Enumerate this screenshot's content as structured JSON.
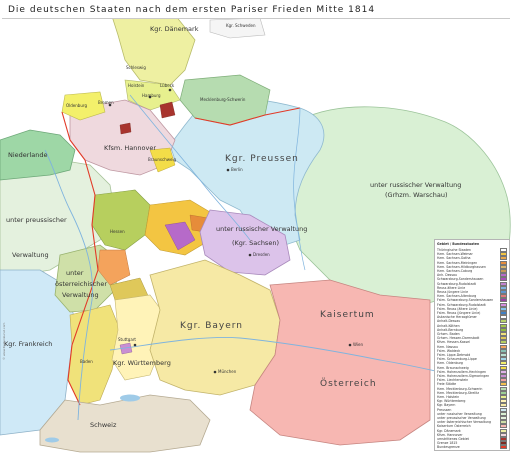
{
  "title": "Die deutschen Staaten nach dem ersten Pariser Frieden Mitte 1814",
  "colors": {
    "sea": "#ffffff",
    "russian_admin": "#d9f0d4",
    "prussia": "#cde9f3",
    "austria": "#f7b7b2",
    "bavaria": "#f6e9a5",
    "france": "#cfe9f7",
    "netherlands": "#9ed7a6",
    "switzerland": "#e8e0cf",
    "denmark": "#eef0a2",
    "hannover": "#efd9de",
    "saxony": "#dcc3ea"
  },
  "labels": {
    "denmark": "Kgr. Dänemark",
    "schweden": "Kgr. Schweden",
    "hannover": "Kfsm. Hannover",
    "preussen": "Kgr. Preussen",
    "russian_admin_1": "unter russischer Verwaltung",
    "russian_admin_2": "(Grhzm. Warschau)",
    "niederlande": "Niederlande",
    "prussian_admin_1": "unter preussischer",
    "prussian_admin_2": "Verwaltung",
    "russian_admin_saxony": "unter russischer Verwaltung",
    "saxony": "(Kgr. Sachsen)",
    "austrian_admin_1": "unter",
    "austrian_admin_2": "österreichischer",
    "austrian_admin_3": "Verwaltung",
    "bayern": "Kgr. Bayern",
    "kaisertum": "Kaisertum",
    "oesterreich": "Österreich",
    "frankreich": "Kgr. Frankreich",
    "wuerttemberg": "Kgr. Württemberg",
    "schweiz": "Schweiz",
    "stuttgart": "Stuttgart",
    "muenchen": "München",
    "berlin": "Berlin",
    "dresden": "Dresden",
    "wien": "Wien",
    "hamburg": "Hamburg",
    "bremen": "Bremen",
    "luebeck": "Lübeck",
    "mecklenburg": "Mecklenburg-Schwerin",
    "hessen": "Hessen",
    "baden": "Baden",
    "oldenburg": "Oldenburg",
    "braunschweig": "Braunschweig",
    "holstein": "Holstein",
    "schleswig": "Schleswig"
  },
  "legend": {
    "header": "Gebiet / Bundesstaaten",
    "items": [
      {
        "label": "Thüringische Staaten",
        "color": "#ffffff"
      },
      {
        "label": "Hzm. Sachsen-Weimar",
        "color": "#f3c542"
      },
      {
        "label": "Hzm. Sachsen-Gotha",
        "color": "#eaa84a"
      },
      {
        "label": "Hzm. Sachsen-Meiningen",
        "color": "#e68c3a"
      },
      {
        "label": "Hzm. Sachsen-Hildburghausen",
        "color": "#d9b56a"
      },
      {
        "label": "Hzm. Sachsen-Coburg",
        "color": "#c89a55"
      },
      {
        "label": "Anh. Dessau",
        "color": "#b66ac9"
      },
      {
        "label": "Schwarzburg-Sondershausen",
        "color": "#a94fb8"
      },
      {
        "label": "Schwarzburg-Rudolstadt",
        "color": "#c283d1"
      },
      {
        "label": "Reuss ältere Linie",
        "color": "#7fb3e0"
      },
      {
        "label": "Reuss jüngere Linie",
        "color": "#5d95cf"
      },
      {
        "label": "Hzm. Sachsen-Altenburg",
        "color": "#e07a7a"
      },
      {
        "label": "Fstm. Schwarzburg-Sondershausen",
        "color": "#9b3fa8"
      },
      {
        "label": "Fstm. Schwarzburg-Rudolstadt",
        "color": "#d48ee0"
      },
      {
        "label": "Fstm. Reuss (ältere Linie)",
        "color": "#87c3ef"
      },
      {
        "label": "Fstm. Reuss (jüngere Linie)",
        "color": "#3f7fc4"
      },
      {
        "label": "Askanische Herzogtümer",
        "color": "#ffffff"
      },
      {
        "label": "Anhalt-Dessau",
        "color": "#b9d46a"
      },
      {
        "label": "Anhalt-Köthen",
        "color": "#a5c84e"
      },
      {
        "label": "Anhalt-Bernburg",
        "color": "#8fbb3f"
      },
      {
        "label": "Grhzm. Baden",
        "color": "#f0e27a"
      },
      {
        "label": "Grhzm. Hessen-Darmstadt",
        "color": "#dfc85a"
      },
      {
        "label": "Kfsm. Hessen-Kassel",
        "color": "#b7cf5e"
      },
      {
        "label": "Hzm. Nassau",
        "color": "#f4a35c"
      },
      {
        "label": "Fstm. Waldeck",
        "color": "#88c0b4"
      },
      {
        "label": "Fstm. Lippe-Detmold",
        "color": "#b9e0d2"
      },
      {
        "label": "Fstm. Schaumburg-Lippe",
        "color": "#a2d6e8"
      },
      {
        "label": "Hzm. Oldenburg",
        "color": "#f3f06b"
      },
      {
        "label": "Hzm. Braunschweig",
        "color": "#f3dd48"
      },
      {
        "label": "Fstm. Hohenzollern-Hechingen",
        "color": "#e0b4e8"
      },
      {
        "label": "Fstm. Hohenzollern-Sigmaringen",
        "color": "#c98ed3"
      },
      {
        "label": "Fstm. Liechtenstein",
        "color": "#f0a0a0"
      },
      {
        "label": "Freie Städte",
        "color": "#f2c04f"
      },
      {
        "label": "Hzm. Mecklenburg-Schwerin",
        "color": "#b6dcb0"
      },
      {
        "label": "Hzm. Mecklenburg-Strelitz",
        "color": "#9ccf95"
      },
      {
        "label": "Hzm. Holstein",
        "color": "#e7f08e"
      },
      {
        "label": "Kgr. Württemberg",
        "color": "#fff3b8"
      },
      {
        "label": "Kgr. Bayern",
        "color": "#f6e9a5"
      },
      {
        "label": "Preussen",
        "color": "#cde9f3"
      },
      {
        "label": "unter russischer Verwaltung",
        "color": "#d9f0d4"
      },
      {
        "label": "unter preussischer Verwaltung",
        "color": "#e4f1de"
      },
      {
        "label": "unter österreichischer Verwaltung",
        "color": "#cfe0a8"
      },
      {
        "label": "Kaisertum Österreich",
        "color": "#f7b7b2"
      },
      {
        "label": "Kgr. Dänemark",
        "color": "#eef0a2"
      },
      {
        "label": "Kfsm. Hannover",
        "color": "#efd9de"
      },
      {
        "label": "umstrittenes Gebiet",
        "color": "#a8342e"
      },
      {
        "label": "Grenze 1815",
        "color": "#7d2a22"
      },
      {
        "label": "Bundesgrenze",
        "color": "#e23a28"
      }
    ]
  },
  "copyright": "© www.Kartenkunst.com"
}
